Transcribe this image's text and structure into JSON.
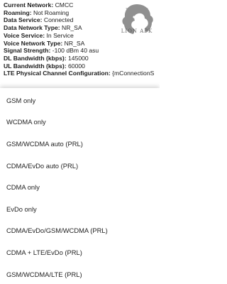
{
  "info": {
    "rows": [
      {
        "key": "Current Network:",
        "value": "CMCC"
      },
      {
        "key": "Roaming:",
        "value": "Not Roaming"
      },
      {
        "key": "Data Service:",
        "value": "Connected"
      },
      {
        "key": "Data Network Type:",
        "value": "NR_SA"
      },
      {
        "key": "Voice Service:",
        "value": "In Service"
      },
      {
        "key": "Voice Network Type:",
        "value": "NR_SA"
      },
      {
        "key": "Signal Strength:",
        "value": "-100 dBm   40 asu"
      },
      {
        "key": "DL Bandwidth (kbps):",
        "value": "145000"
      },
      {
        "key": "UL Bandwidth (kbps):",
        "value": "60000"
      },
      {
        "key": "LTE Physical Channel Configuration:",
        "value": "{mConnectionS"
      }
    ]
  },
  "watermark": {
    "text": "LION APK"
  },
  "network_mode_options": [
    "GSM only",
    "WCDMA only",
    "GSM/WCDMA auto (PRL)",
    "CDMA/EvDo auto (PRL)",
    "CDMA only",
    "EvDo only",
    "CDMA/EvDo/GSM/WCDMA (PRL)",
    "CDMA + LTE/EvDo (PRL)",
    "GSM/WCDMA/LTE (PRL)"
  ]
}
